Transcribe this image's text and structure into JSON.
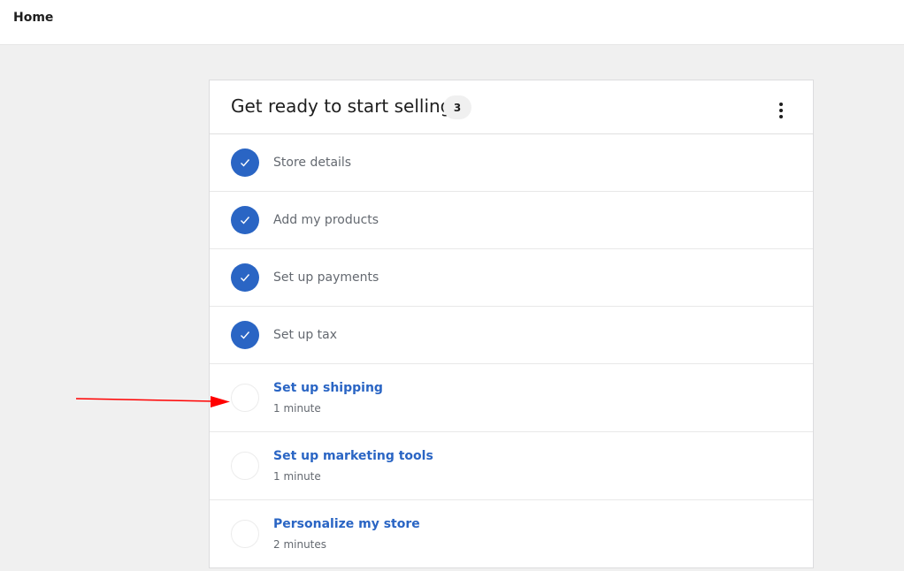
{
  "topbar": {
    "title": "Home"
  },
  "card": {
    "title": "Get ready to start selling",
    "count": "3",
    "menu_icon": "more-vertical-icon",
    "tasks_done": [
      {
        "label": "Store details"
      },
      {
        "label": "Add my products"
      },
      {
        "label": "Set up payments"
      },
      {
        "label": "Set up tax"
      }
    ],
    "tasks_todo": [
      {
        "label": "Set up shipping",
        "time": "1 minute"
      },
      {
        "label": "Set up marketing tools",
        "time": "1 minute"
      },
      {
        "label": "Personalize my store",
        "time": "2 minutes"
      }
    ]
  },
  "colors": {
    "accent": "#2a65c4",
    "background": "#f0f0f0",
    "annotation_arrow": "#ff0000"
  }
}
